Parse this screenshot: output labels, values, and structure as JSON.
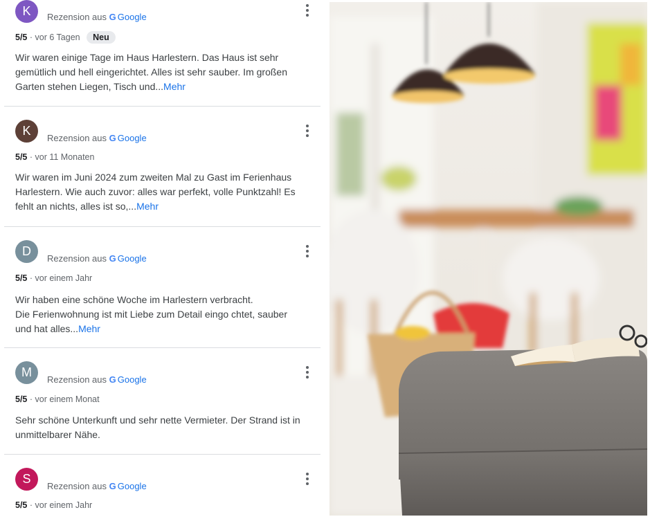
{
  "colors": {
    "link": "#1a73e8",
    "avatar_k1": "#7e57c2",
    "avatar_k2": "#5d4037",
    "avatar_d": "#78909c",
    "avatar_m": "#78909c",
    "avatar_s": "#c2185b"
  },
  "reviews": [
    {
      "initial": "K",
      "source_prefix": "Rezension aus",
      "source_name": "Google",
      "rating": "5/5",
      "time": "· vor 6 Tagen",
      "badge": "Neu",
      "lines": [
        "Wir waren einige Tage im Haus Harlestern. Das Haus ist sehr",
        "gemütlich und hell eingerichtet. Alles ist sehr sauber. Im großen",
        "Garten stehen Liegen, Tisch und..."
      ],
      "more": "Mehr"
    },
    {
      "initial": "K",
      "source_prefix": "Rezension aus",
      "source_name": "Google",
      "rating": "5/5",
      "time": "· vor 11 Monaten",
      "lines": [
        "Wir waren im Juni 2024 zum zweiten Mal zu Gast im Ferienhaus",
        "Harlestern. Wie auch zuvor: alles war perfekt, volle Punktzahl! Es",
        "fehlt an nichts, alles ist so,..."
      ],
      "more": "Mehr"
    },
    {
      "initial": "D",
      "source_prefix": "Rezension aus",
      "source_name": "Google",
      "rating": "5/5",
      "time": "· vor einem Jahr",
      "lines": [
        "Wir haben eine schöne Woche im Harlestern verbracht.",
        "Die Ferienwohnung ist mit Liebe zum Detail eingo  chtet, sauber",
        "und hat alles..."
      ],
      "more": "Mehr"
    },
    {
      "initial": "M",
      "source_prefix": "Rezension aus",
      "source_name": "Google",
      "rating": "5/5",
      "time": "· vor einem Monat",
      "lines": [
        "Sehr schöne Unterkunft und sehr nette Vermieter. Der Strand ist in",
        "unmittelbarer Nähe."
      ]
    },
    {
      "initial": "S",
      "source_prefix": "Rezension aus",
      "source_name": "Google",
      "rating": "5/5",
      "time": "· vor einem Jahr"
    }
  ]
}
